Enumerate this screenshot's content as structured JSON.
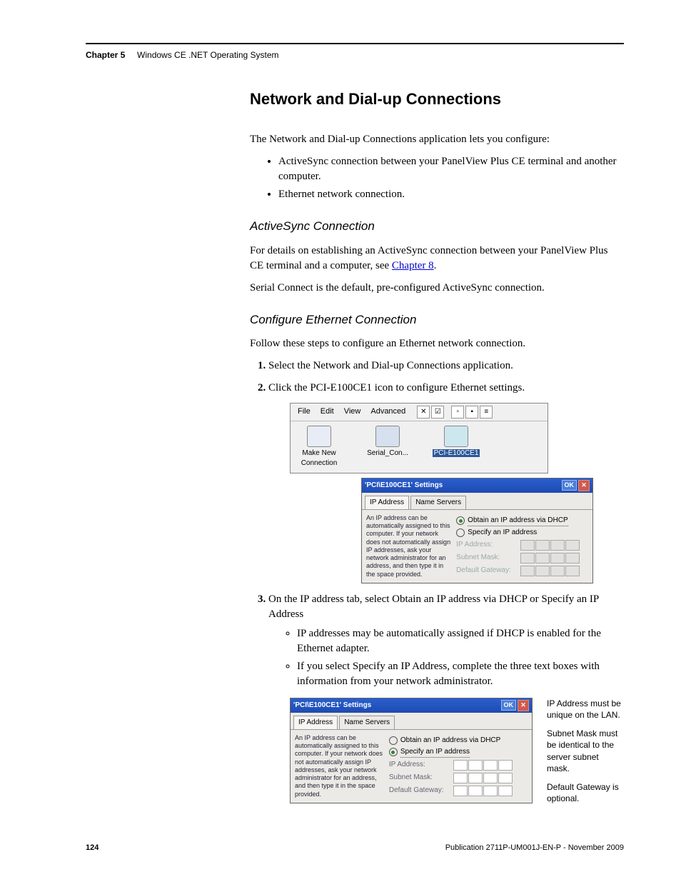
{
  "header": {
    "chapter_num": "Chapter 5",
    "chapter_title": "Windows CE .NET Operating System"
  },
  "section_title": "Network and Dial-up Connections",
  "intro": "The Network and Dial-up Connections application lets you configure:",
  "intro_bullets": [
    "ActiveSync connection between your PanelView Plus CE terminal and another computer.",
    "Ethernet network connection."
  ],
  "sub1_title": "ActiveSync Connection",
  "sub1_p1a": "For details on establishing an ActiveSync connection between your PanelView Plus CE terminal and a computer, see ",
  "sub1_p1_link": "Chapter 8",
  "sub1_p1b": ".",
  "sub1_p2": "Serial Connect is the default, pre-configured ActiveSync connection.",
  "sub2_title": "Configure Ethernet Connection",
  "sub2_intro": "Follow these steps to configure an Ethernet network connection.",
  "steps": {
    "s1": "Select the Network and Dial-up Connections application.",
    "s2": "Click the PCI-E100CE1 icon to configure Ethernet settings.",
    "s3": "On the IP address tab, select Obtain an IP address via DHCP or Specify an IP Address",
    "s3_bullets": [
      "IP addresses may be automatically assigned if DHCP is enabled for the Ethernet adapter.",
      "If you select Specify an IP Address, complete the three text boxes with information from your network administrator."
    ]
  },
  "ss1": {
    "menu": {
      "file": "File",
      "edit": "Edit",
      "view": "View",
      "advanced": "Advanced"
    },
    "icons": {
      "make_new": "Make New Connection",
      "serial": "Serial_Con...",
      "pci": "PCI-E100CE1"
    }
  },
  "dlg": {
    "title": "'PCI\\E100CE1' Settings",
    "ok": "OK",
    "tab_ip": "IP Address",
    "tab_ns": "Name Servers",
    "desc": "An IP address can be automatically assigned to this computer. If your network does not automatically assign IP addresses, ask your network administrator for an address, and then type it in the space provided.",
    "radio_dhcp": "Obtain an IP address via DHCP",
    "radio_specify": "Specify an IP address",
    "lbl_ip": "IP Address:",
    "lbl_mask": "Subnet Mask:",
    "lbl_gw": "Default Gateway:"
  },
  "notes": {
    "n1": "IP Address must be unique on the LAN.",
    "n2": "Subnet Mask must be identical to the server subnet mask.",
    "n3": "Default Gateway is optional."
  },
  "footer": {
    "page": "124",
    "pub": "Publication 2711P-UM001J-EN-P - November 2009"
  },
  "chart_data": null
}
